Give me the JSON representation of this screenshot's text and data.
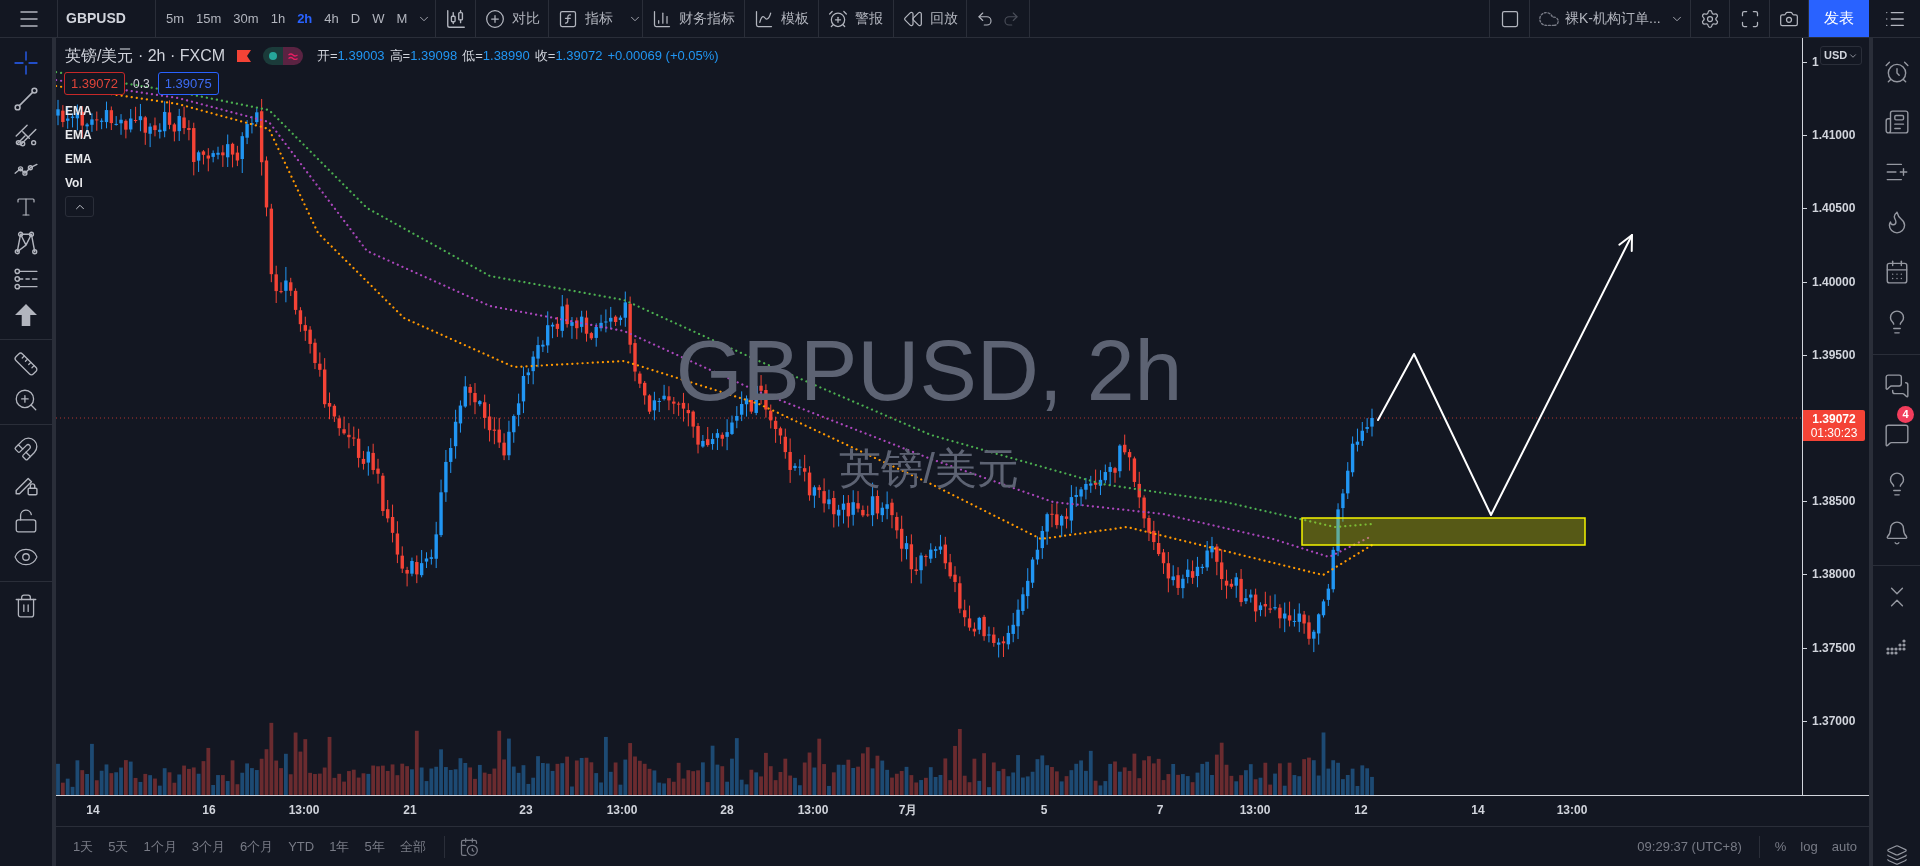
{
  "top_toolbar": {
    "symbol": "GBPUSD",
    "intervals": [
      {
        "label": "5m",
        "selected": false
      },
      {
        "label": "15m",
        "selected": false
      },
      {
        "label": "30m",
        "selected": false
      },
      {
        "label": "1h",
        "selected": false
      },
      {
        "label": "2h",
        "selected": true
      },
      {
        "label": "4h",
        "selected": false
      },
      {
        "label": "D",
        "selected": false
      },
      {
        "label": "W",
        "selected": false
      },
      {
        "label": "M",
        "selected": false
      }
    ],
    "tools": [
      {
        "kind": "compare",
        "label": "对比"
      },
      {
        "kind": "indicators",
        "label": "指标"
      },
      {
        "kind": "financials",
        "label": "财务指标"
      },
      {
        "kind": "templates",
        "label": "模板"
      },
      {
        "kind": "alert",
        "label": "警报"
      },
      {
        "kind": "replay",
        "label": "回放"
      }
    ],
    "history": [
      {
        "kind": "undo",
        "disabled": false
      },
      {
        "kind": "redo",
        "disabled": true
      }
    ],
    "layout": "裸K-机构订单...",
    "publish": "发表"
  },
  "drawing_toolbar": [
    [
      {
        "kind": "crosshair",
        "selected": true
      },
      {
        "kind": "trend_line",
        "selected": false
      },
      {
        "kind": "pitchfork",
        "selected": false
      },
      {
        "kind": "path",
        "selected": false
      },
      {
        "kind": "text",
        "selected": false
      },
      {
        "kind": "pattern",
        "selected": false
      },
      {
        "kind": "levels",
        "selected": false
      },
      {
        "kind": "arrow",
        "selected": false
      }
    ],
    [
      {
        "kind": "ruler",
        "selected": false
      },
      {
        "kind": "zoom",
        "selected": false
      }
    ],
    [
      {
        "kind": "magnet",
        "selected": false
      },
      {
        "kind": "lock_drawings",
        "selected": false
      },
      {
        "kind": "lock",
        "selected": false
      },
      {
        "kind": "visibility",
        "selected": false
      }
    ],
    [
      {
        "kind": "trash",
        "selected": false
      }
    ]
  ],
  "legend": {
    "title": "英镑/美元 · 2h · FXCM",
    "quick_trade": {
      "on": true
    },
    "ohlc": [
      {
        "label": "开=",
        "value": "1.39003"
      },
      {
        "label": "高=",
        "value": "1.39098"
      },
      {
        "label": "低=",
        "value": "1.38990"
      },
      {
        "label": "收=",
        "value": "1.39072"
      }
    ],
    "change": "+0.00069 (+0.05%)",
    "sell": "1.39072",
    "spread": "0.3",
    "buy": "1.39075",
    "indicators": [
      "EMA",
      "EMA",
      "EMA",
      "Vol"
    ]
  },
  "watermark": {
    "symbol": "GBPUSD, 2h",
    "description": "英镑/美元"
  },
  "price_axis": {
    "currency": "USD",
    "ticks": [
      "1",
      "1.41000",
      "1.40500",
      "1.40000",
      "1.39500",
      "1.38500",
      "1.38000",
      "1.37500",
      "1.37000"
    ],
    "last_price": "1.39072",
    "countdown": "01:30:23"
  },
  "time_axis": [
    "14",
    "16",
    "13:00",
    "21",
    "23",
    "13:00",
    "28",
    "13:00",
    "7月",
    "5",
    "7",
    "13:00",
    "12",
    "14",
    "13:00"
  ],
  "bottom_bar": {
    "ranges": [
      "1天",
      "5天",
      "1个月",
      "3个月",
      "6个月",
      "YTD",
      "1年",
      "5年",
      "全部"
    ],
    "clock": "09:29:37 (UTC+8)",
    "scale_options": [
      "%",
      "log",
      "auto"
    ]
  },
  "right_toolbar": {
    "badge": "4"
  }
}
